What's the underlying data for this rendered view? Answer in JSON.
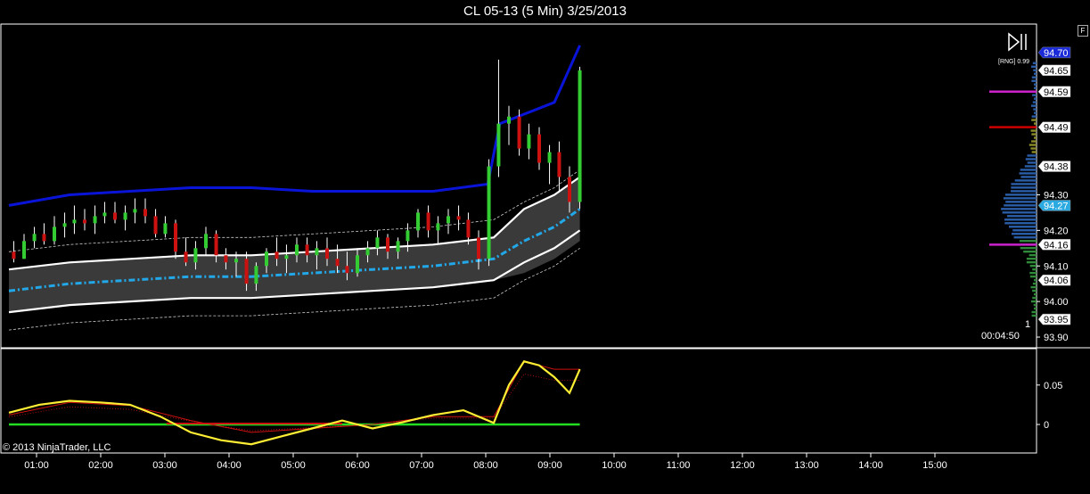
{
  "title": "CL 05-13 (5 Min)  3/25/2013",
  "copyright": "© 2013 NinjaTrader, LLC",
  "timer": "00:04:50",
  "rng_label": "[RNG] 0.99",
  "row_count_label": "1",
  "flag_label": "F",
  "icon_names": [
    "play-pause-icon"
  ],
  "colors": {
    "bull": "#33cc33",
    "bear": "#cc1111",
    "upper_band": "#0a14d8",
    "mid_band": "#22a8e8",
    "oscillator_main": "#ffee33",
    "oscillator_signal": "#cc1111",
    "oscillator_zero": "#22dd22",
    "volume_profile": "#2a5ea8",
    "poc": "#cc0000",
    "value_area": "#cc22cc"
  },
  "chart_data": [
    {
      "type": "candlestick",
      "x_axis_ticks": [
        "01:00",
        "02:00",
        "03:00",
        "04:00",
        "05:00",
        "06:00",
        "07:00",
        "08:00",
        "09:00",
        "10:00",
        "11:00",
        "12:00",
        "13:00",
        "14:00",
        "15:00"
      ],
      "y_axis_ticks": [
        "94.30",
        "94.20",
        "94.10",
        "94.00",
        "93.90"
      ],
      "price_labels": [
        {
          "value": "94.70",
          "style": "blue"
        },
        {
          "value": "94.65",
          "style": "white"
        },
        {
          "value": "94.59",
          "style": "white"
        },
        {
          "value": "94.49",
          "style": "white"
        },
        {
          "value": "94.38",
          "style": "white"
        },
        {
          "value": "94.27",
          "style": "cyan"
        },
        {
          "value": "94.16",
          "style": "white"
        },
        {
          "value": "94.06",
          "style": "white"
        },
        {
          "value": "93.95",
          "style": "white"
        }
      ],
      "ylim": [
        93.87,
        94.78
      ],
      "candles": [
        [
          0.08,
          94.14,
          94.17,
          94.11,
          94.12
        ],
        [
          0.25,
          94.12,
          94.19,
          94.12,
          94.17
        ],
        [
          0.42,
          94.17,
          94.21,
          94.15,
          94.19
        ],
        [
          0.58,
          94.19,
          94.22,
          94.16,
          94.17
        ],
        [
          0.75,
          94.17,
          94.24,
          94.16,
          94.21
        ],
        [
          0.92,
          94.21,
          94.25,
          94.18,
          94.22
        ],
        [
          1.08,
          94.22,
          94.27,
          94.19,
          94.23
        ],
        [
          1.25,
          94.23,
          94.26,
          94.2,
          94.22
        ],
        [
          1.42,
          94.22,
          94.27,
          94.19,
          94.24
        ],
        [
          1.58,
          94.24,
          94.28,
          94.22,
          94.25
        ],
        [
          1.75,
          94.25,
          94.28,
          94.22,
          94.23
        ],
        [
          1.92,
          94.23,
          94.27,
          94.2,
          94.25
        ],
        [
          2.08,
          94.25,
          94.29,
          94.22,
          94.26
        ],
        [
          2.25,
          94.26,
          94.29,
          94.22,
          94.24
        ],
        [
          2.42,
          94.24,
          94.26,
          94.18,
          94.19
        ],
        [
          2.58,
          94.19,
          94.24,
          94.18,
          94.22
        ],
        [
          2.75,
          94.22,
          94.23,
          94.12,
          94.14
        ],
        [
          2.92,
          94.14,
          94.18,
          94.1,
          94.11
        ],
        [
          3.08,
          94.11,
          94.17,
          94.09,
          94.15
        ],
        [
          3.25,
          94.15,
          94.21,
          94.13,
          94.19
        ],
        [
          3.42,
          94.19,
          94.2,
          94.11,
          94.13
        ],
        [
          3.58,
          94.13,
          94.15,
          94.09,
          94.11
        ],
        [
          3.75,
          94.11,
          94.14,
          94.07,
          94.12
        ],
        [
          3.92,
          94.12,
          94.14,
          94.03,
          94.05
        ],
        [
          4.08,
          94.05,
          94.11,
          94.03,
          94.1
        ],
        [
          4.25,
          94.1,
          94.15,
          94.08,
          94.14
        ],
        [
          4.42,
          94.14,
          94.18,
          94.1,
          94.12
        ],
        [
          4.58,
          94.12,
          94.16,
          94.08,
          94.13
        ],
        [
          4.75,
          94.13,
          94.18,
          94.11,
          94.16
        ],
        [
          4.92,
          94.16,
          94.18,
          94.11,
          94.13
        ],
        [
          5.08,
          94.13,
          94.17,
          94.09,
          94.15
        ],
        [
          5.25,
          94.15,
          94.18,
          94.1,
          94.12
        ],
        [
          5.42,
          94.12,
          94.16,
          94.08,
          94.1
        ],
        [
          5.58,
          94.1,
          94.14,
          94.06,
          94.08
        ],
        [
          5.75,
          94.08,
          94.15,
          94.07,
          94.13
        ],
        [
          5.92,
          94.13,
          94.17,
          94.11,
          94.15
        ],
        [
          6.08,
          94.15,
          94.2,
          94.13,
          94.18
        ],
        [
          6.25,
          94.18,
          94.19,
          94.12,
          94.14
        ],
        [
          6.42,
          94.14,
          94.18,
          94.12,
          94.17
        ],
        [
          6.58,
          94.17,
          94.22,
          94.14,
          94.2
        ],
        [
          6.75,
          94.2,
          94.26,
          94.18,
          94.25
        ],
        [
          6.92,
          94.25,
          94.27,
          94.18,
          94.2
        ],
        [
          7.08,
          94.2,
          94.24,
          94.16,
          94.22
        ],
        [
          7.25,
          94.22,
          94.26,
          94.19,
          94.24
        ],
        [
          7.42,
          94.24,
          94.27,
          94.2,
          94.23
        ],
        [
          7.58,
          94.23,
          94.25,
          94.16,
          94.18
        ],
        [
          7.75,
          94.18,
          94.2,
          94.09,
          94.12
        ],
        [
          7.92,
          94.12,
          94.4,
          94.1,
          94.38
        ],
        [
          8.08,
          94.38,
          94.68,
          94.35,
          94.5
        ],
        [
          8.25,
          94.5,
          94.55,
          94.44,
          94.52
        ],
        [
          8.42,
          94.52,
          94.54,
          94.41,
          94.43
        ],
        [
          8.58,
          94.43,
          94.5,
          94.4,
          94.47
        ],
        [
          8.75,
          94.47,
          94.49,
          94.37,
          94.39
        ],
        [
          8.92,
          94.39,
          94.44,
          94.33,
          94.42
        ],
        [
          9.08,
          94.42,
          94.45,
          94.31,
          94.35
        ],
        [
          9.25,
          94.35,
          94.38,
          94.25,
          94.28
        ],
        [
          9.42,
          94.28,
          94.66,
          94.26,
          94.65
        ]
      ],
      "bands": {
        "upper_outer": [
          [
            0,
            94.27
          ],
          [
            1,
            94.3
          ],
          [
            2,
            94.31
          ],
          [
            3,
            94.32
          ],
          [
            4,
            94.32
          ],
          [
            5,
            94.31
          ],
          [
            6,
            94.31
          ],
          [
            7,
            94.31
          ],
          [
            7.9,
            94.33
          ],
          [
            8.1,
            94.5
          ],
          [
            9,
            94.56
          ],
          [
            9.42,
            94.72
          ]
        ],
        "mid": [
          [
            0,
            94.03
          ],
          [
            1,
            94.05
          ],
          [
            2,
            94.06
          ],
          [
            3,
            94.07
          ],
          [
            4,
            94.07
          ],
          [
            5,
            94.08
          ],
          [
            6,
            94.09
          ],
          [
            7,
            94.1
          ],
          [
            8,
            94.12
          ],
          [
            8.5,
            94.17
          ],
          [
            9,
            94.21
          ],
          [
            9.42,
            94.26
          ]
        ]
      }
    },
    {
      "type": "line",
      "y_axis_ticks": [
        "0.05",
        "0"
      ],
      "ylim": [
        -0.035,
        0.095
      ],
      "series": [
        {
          "values": [
            [
              0,
              0.015
            ],
            [
              0.5,
              0.025
            ],
            [
              1,
              0.03
            ],
            [
              1.5,
              0.028
            ],
            [
              2,
              0.025
            ],
            [
              2.5,
              0.01
            ],
            [
              3,
              -0.01
            ],
            [
              3.5,
              -0.02
            ],
            [
              4,
              -0.025
            ],
            [
              4.5,
              -0.015
            ],
            [
              5,
              -0.005
            ],
            [
              5.5,
              0.005
            ],
            [
              6,
              -0.005
            ],
            [
              6.5,
              0.003
            ],
            [
              7,
              0.012
            ],
            [
              7.5,
              0.018
            ],
            [
              8,
              0.002
            ],
            [
              8.25,
              0.05
            ],
            [
              8.5,
              0.08
            ],
            [
              8.75,
              0.075
            ],
            [
              9,
              0.06
            ],
            [
              9.25,
              0.04
            ],
            [
              9.42,
              0.07
            ]
          ]
        },
        {
          "values": [
            [
              0,
              0.012
            ],
            [
              1,
              0.028
            ],
            [
              2,
              0.024
            ],
            [
              3,
              0.005
            ],
            [
              4,
              -0.01
            ],
            [
              5,
              -0.005
            ],
            [
              6,
              0.0
            ],
            [
              7,
              0.01
            ],
            [
              8,
              0.01
            ],
            [
              8.5,
              0.08
            ],
            [
              9,
              0.07
            ],
            [
              9.42,
              0.07
            ]
          ]
        }
      ]
    }
  ]
}
